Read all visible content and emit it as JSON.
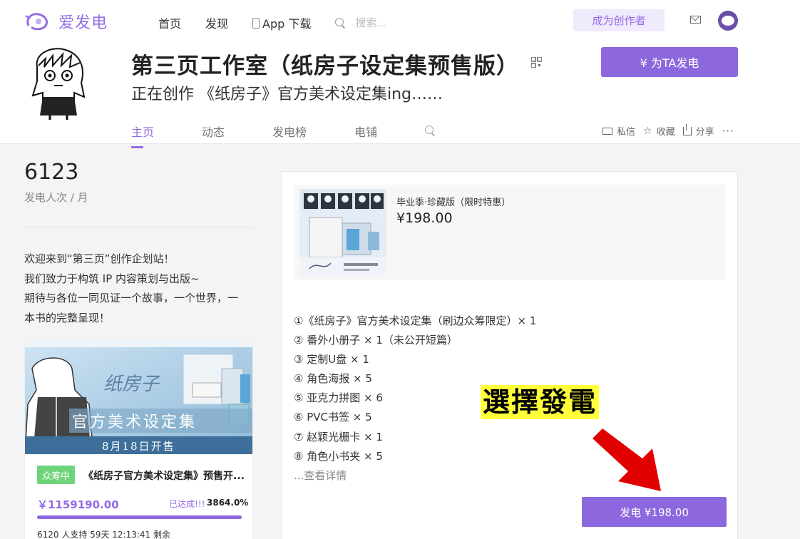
{
  "header": {
    "logo_text": "爱发电",
    "nav": {
      "home": "首页",
      "discover": "发现",
      "app_download": "App 下载"
    },
    "search_placeholder": "搜索...",
    "become_creator": "成为创作者"
  },
  "profile": {
    "title": "第三页工作室（纸房子设定集预售版）",
    "subtitle": "正在创作 《纸房子》官方美术设定集ing……",
    "sponsor_button": "¥  为TA发电"
  },
  "tabs": [
    {
      "label": "主页",
      "active": true
    },
    {
      "label": "动态",
      "active": false
    },
    {
      "label": "发电榜",
      "active": false
    },
    {
      "label": "电铺",
      "active": false
    }
  ],
  "actions": {
    "message": "私信",
    "favorite": "收藏",
    "share": "分享",
    "more": "···"
  },
  "stats": {
    "count": "6123",
    "label": "发电人次 / 月"
  },
  "intro_lines": [
    "欢迎来到“第三页”创作企划站！",
    "我们致力于构筑 IP 内容策划与出版~",
    "期待与各位一同见证一个故事，一个世界，一",
    "本书的完整呈现！"
  ],
  "campaign": {
    "image_title": "纸房子",
    "image_subtitle": "官方美术设定集",
    "image_date": "8月18日开售",
    "badge": "众筹中",
    "title": "《纸房子官方美术设定集》预售开...",
    "raised": "￥1159190.00",
    "reached": "已达成!!!",
    "percent": "3864.0%",
    "progress_fraction": 1.0,
    "supporters": "6120 人支持  59天 12:13:41 剩余"
  },
  "tier": {
    "name": "毕业季·珍藏版（限时特惠）",
    "price": "¥198.00",
    "items": [
      "①《纸房子》官方美术设定集（刷边众筹限定）× 1",
      "② 番外小册子 × 1（未公开短篇）",
      "③ 定制U盘 × 1",
      "④ 角色海报 × 5",
      "⑤ 亚克力拼图 × 6",
      "⑥ PVC书签 × 5",
      "⑦ 赵颖光栅卡 × 1",
      "⑧ 角色小书夹 × 5"
    ],
    "more": "...查看详情",
    "pay_button": "发电 ¥198.00"
  },
  "callout": "選擇發電",
  "colors": {
    "accent": "#8c67dd",
    "badge": "#6ed47a",
    "highlight": "#ffff3a",
    "arrow": "#e10000"
  }
}
